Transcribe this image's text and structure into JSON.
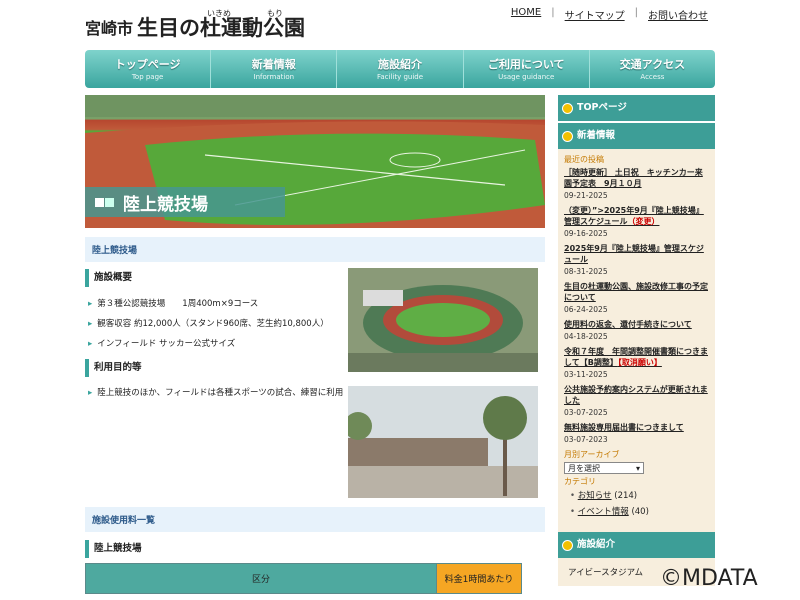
{
  "header": {
    "city": "宮崎市",
    "park_name": "生目の杜運動公園",
    "ruby_ikime": "いきめ",
    "ruby_mori": "もり",
    "links": [
      "HOME",
      "サイトマップ",
      "お問い合わせ"
    ]
  },
  "nav": [
    {
      "jp": "トップページ",
      "en": "Top page"
    },
    {
      "jp": "新着情報",
      "en": "Information"
    },
    {
      "jp": "施設紹介",
      "en": "Facility guide"
    },
    {
      "jp": "ご利用について",
      "en": "Usage guidance"
    },
    {
      "jp": "交通アクセス",
      "en": "Access"
    }
  ],
  "hero": {
    "caption": "陸上競技場"
  },
  "main": {
    "section_title": "陸上競技場",
    "overview_title": "施設概要",
    "overview_items": [
      "第３種公認競技場　　1周400m×9コース",
      "観客収容 約12,000人（スタンド960席、芝生約10,800人）",
      "インフィールド サッカー公式サイズ"
    ],
    "purpose_title": "利用目的等",
    "purpose_items": [
      "陸上競技のほか、フィールドは各種スポーツの試合、練習に利用"
    ],
    "fee_title": "施設使用料一覧",
    "fee_section": "陸上競技場",
    "table_headers": [
      "区分",
      "料金1時間あたり"
    ]
  },
  "sidebar": {
    "top_label": "TOPページ",
    "news_label": "新着情報",
    "recent_label": "最近の投稿",
    "posts": [
      {
        "title": "［随時更新］ 土日祝　キッチンカー来園予定表　9月１０月",
        "date": "09-21-2025"
      },
      {
        "title": "（変更）”>2025年9月『陸上競技場』管理スケジュール",
        "title_red": "（変更）",
        "date": "09-16-2025"
      },
      {
        "title": "2025年9月『陸上競技場』管理スケジュール",
        "date": "08-31-2025"
      },
      {
        "title": "生目の杜運動公園、施設改修工事の予定について",
        "date": "06-24-2025"
      },
      {
        "title": "使用料の返金、還付手続きについて",
        "date": "04-18-2025"
      },
      {
        "title": "令和７年度　年間調整開催書類につきまして【B調整】",
        "title_red": "【取消願い】",
        "date": "03-11-2025"
      },
      {
        "title": "公共施設予約案内システムが更新されました",
        "date": "03-07-2025"
      },
      {
        "title": "無料施設専用届出書につきまして",
        "date": "03-07-2023"
      }
    ],
    "archive_label": "月別アーカイブ",
    "archive_select": "月を選択",
    "category_label": "カテゴリ",
    "categories": [
      {
        "name": "お知らせ",
        "count": "(214)"
      },
      {
        "name": "イベント情報",
        "count": "(40)"
      }
    ],
    "facility_label": "施設紹介",
    "facility_item": "アイビースタジアム"
  },
  "watermark": "©MDATA",
  "colors": {
    "accent": "#3aa59e",
    "news_bg": "#f7eedd",
    "orange": "#f5a623"
  }
}
